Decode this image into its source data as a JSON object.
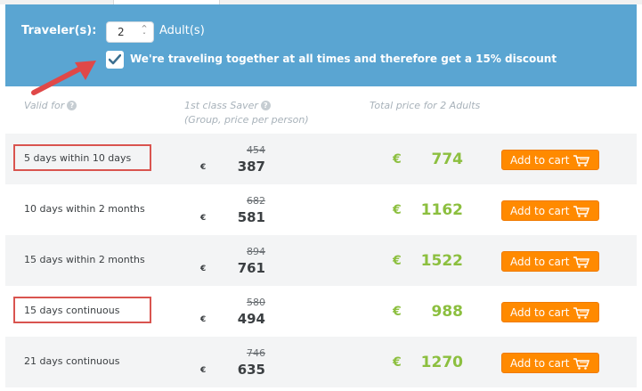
{
  "header": {
    "travelers_label": "Traveler(s):",
    "travelers_value": "2",
    "adults_label": "Adult(s)",
    "together_text_pre": "We're traveling together at all times and therefore get a ",
    "together_text_bold": "15% discount"
  },
  "columns": {
    "valid_for": "Valid for",
    "class_line1": "1st class Saver",
    "class_line2": "(Group, price per person)",
    "total": "Total price for 2 Adults"
  },
  "currency": "€",
  "rows": [
    {
      "validity": "5 days within 10 days",
      "old_price": "454",
      "new_price": "387",
      "total": "774",
      "cart": "Add to cart"
    },
    {
      "validity": "10 days within 2 months",
      "old_price": "682",
      "new_price": "581",
      "total": "1162",
      "cart": "Add to cart"
    },
    {
      "validity": "15 days within 2 months",
      "old_price": "894",
      "new_price": "761",
      "total": "1522",
      "cart": "Add to cart"
    },
    {
      "validity": "15 days continuous",
      "old_price": "580",
      "new_price": "494",
      "total": "988",
      "cart": "Add to cart"
    },
    {
      "validity": "21 days continuous",
      "old_price": "746",
      "new_price": "635",
      "total": "1270",
      "cart": "Add to cart"
    }
  ],
  "colors": {
    "header_bg": "#5aa5d2",
    "price_green": "#8cbf3f",
    "cart_orange": "#ff8a00",
    "highlight_red": "#d9544f"
  },
  "icons": {
    "question": "question-circle-icon",
    "cart": "shopping-cart-icon",
    "check": "check-icon",
    "arrow": "red-pointer-arrow"
  }
}
